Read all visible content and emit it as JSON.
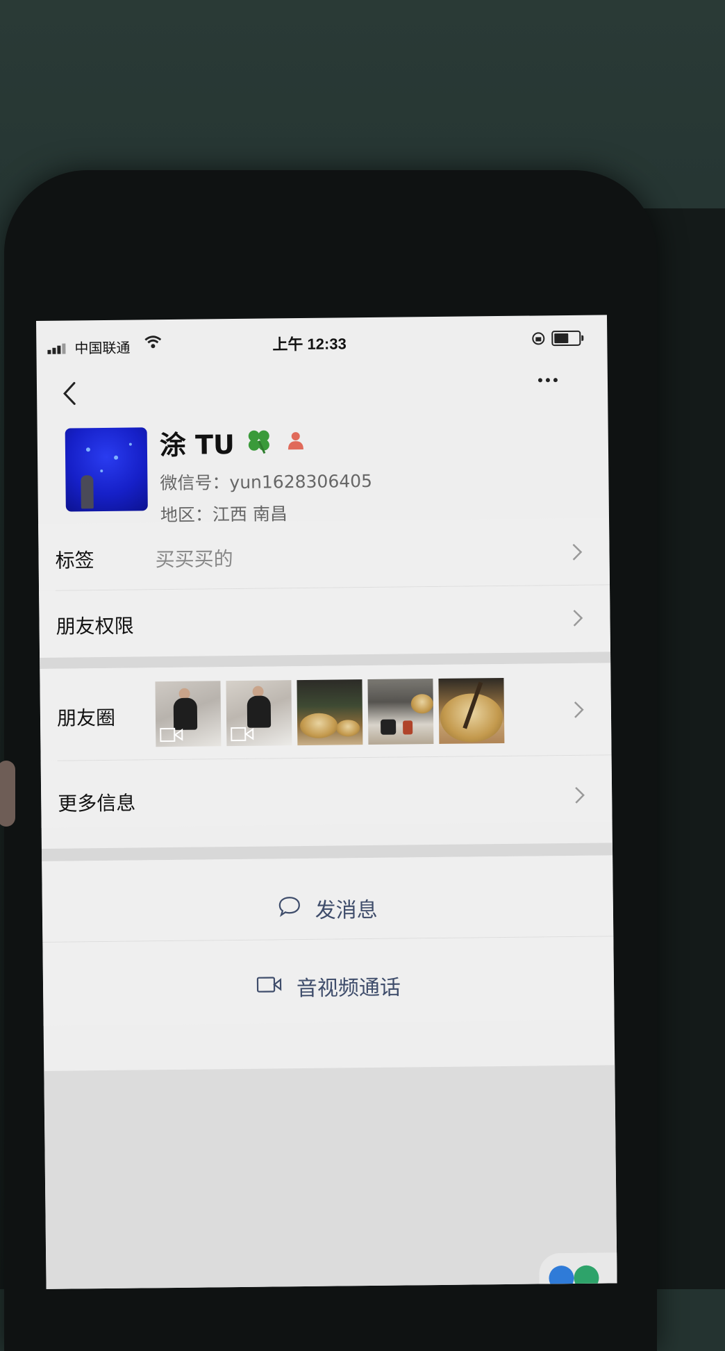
{
  "status_bar": {
    "carrier": "中国联通",
    "time": "上午 12:33"
  },
  "profile": {
    "name": "涂 TU",
    "wechat_id": "微信号：yun1628306405",
    "region": "地区：江西 南昌"
  },
  "rows": {
    "tags_label": "标签",
    "tags_value": "买买买的",
    "permissions_label": "朋友权限",
    "moments_label": "朋友圈",
    "more_info_label": "更多信息"
  },
  "actions": {
    "send_message": "发消息",
    "video_call": "音视频通话"
  },
  "icons": {
    "back": "chevron-left-icon",
    "more": "ellipsis-icon",
    "clover": "four-leaf-clover-icon",
    "gender": "person-icon",
    "chat": "chat-bubble-icon",
    "video": "video-camera-icon"
  },
  "colors": {
    "action_text": "#3f4d6b",
    "clover": "#3a9a3a",
    "gender_badge": "#e06a5a"
  }
}
